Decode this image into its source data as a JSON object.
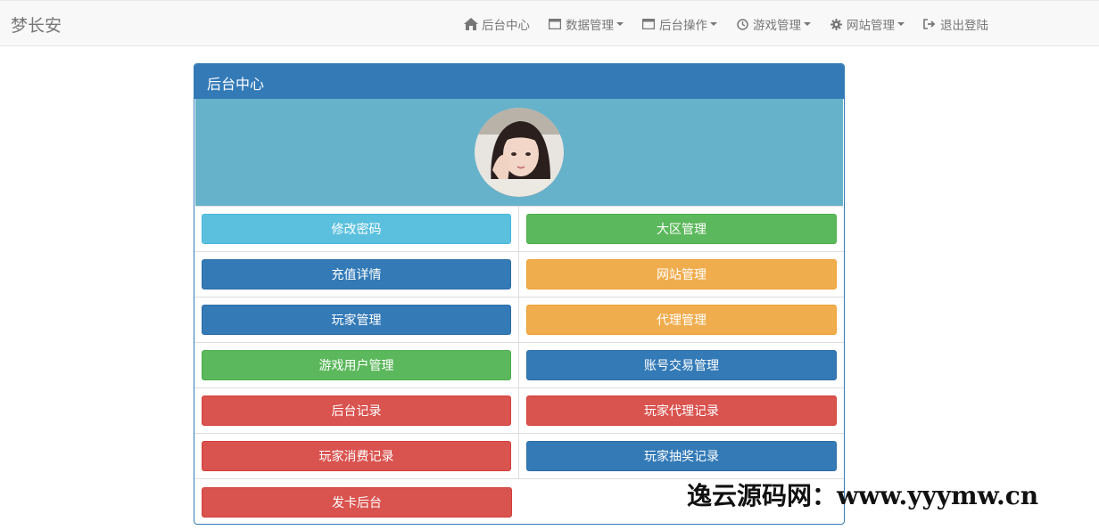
{
  "brand": "梦长安",
  "nav": [
    {
      "label": "后台中心",
      "icon": "home-icon",
      "dropdown": false
    },
    {
      "label": "数据管理",
      "icon": "window-icon",
      "dropdown": true
    },
    {
      "label": "后台操作",
      "icon": "window-icon",
      "dropdown": true
    },
    {
      "label": "游戏管理",
      "icon": "clock-icon",
      "dropdown": true
    },
    {
      "label": "网站管理",
      "icon": "gear-icon",
      "dropdown": true
    },
    {
      "label": "退出登陆",
      "icon": "sign-out-icon",
      "dropdown": false
    }
  ],
  "panel": {
    "title": "后台中心",
    "header_color": "#337ab7",
    "avatar_bg": "#66b2ca"
  },
  "buttons": [
    [
      "修改密码",
      "大区管理"
    ],
    [
      "充值详情",
      "网站管理"
    ],
    [
      "玩家管理",
      "代理管理"
    ],
    [
      "游戏用户管理",
      "账号交易管理"
    ],
    [
      "后台记录",
      "玩家代理记录"
    ],
    [
      "玩家消费记录",
      "玩家抽奖记录"
    ],
    [
      "发卡后台"
    ]
  ],
  "colors": {
    "info": "#5bc0de",
    "success": "#5cb85c",
    "primary": "#337ab7",
    "warning": "#f0ad4e",
    "danger": "#d9534f"
  },
  "watermark": "逸云源码网：www.yyymw.cn"
}
